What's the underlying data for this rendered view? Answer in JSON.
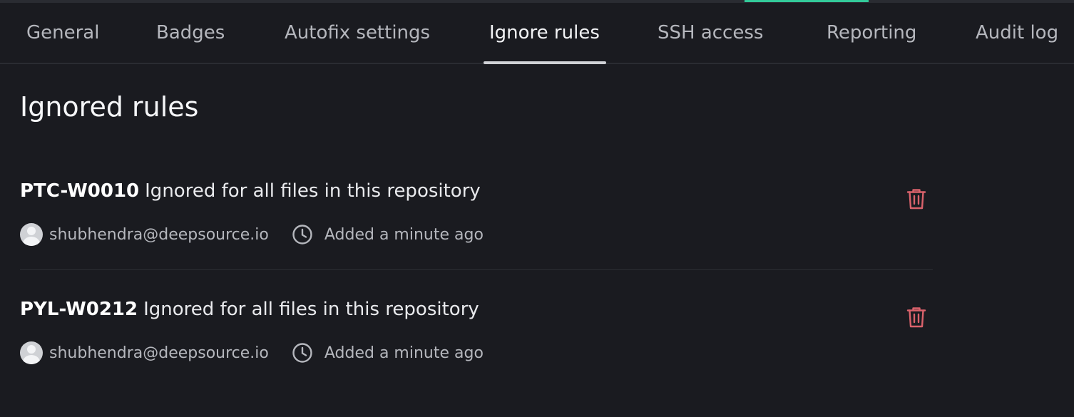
{
  "tabs": [
    {
      "label": "General"
    },
    {
      "label": "Badges"
    },
    {
      "label": "Autofix settings"
    },
    {
      "label": "Ignore rules"
    },
    {
      "label": "SSH access"
    },
    {
      "label": "Reporting"
    },
    {
      "label": "Audit log"
    }
  ],
  "active_tab": "Ignore rules",
  "page": {
    "title": "Ignored rules"
  },
  "rules": [
    {
      "code": "PTC-W0010",
      "scope": "Ignored for all files in this repository",
      "author": "shubhendra@deepsource.io",
      "added": "Added a minute ago"
    },
    {
      "code": "PYL-W0212",
      "scope": "Ignored for all files in this repository",
      "author": "shubhendra@deepsource.io",
      "added": "Added a minute ago"
    }
  ],
  "icons": {
    "author": "avatar",
    "time": "clock-icon",
    "delete": "trash-icon"
  },
  "colors": {
    "accent": "#33cb9a",
    "danger": "#d9626b",
    "background": "#1a1b20"
  }
}
